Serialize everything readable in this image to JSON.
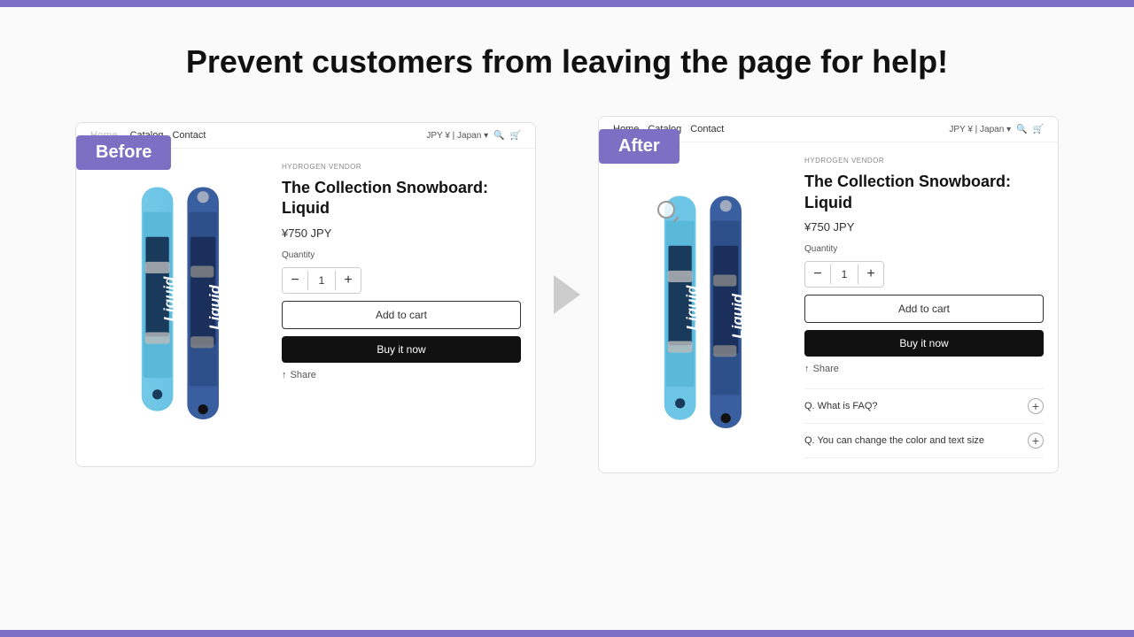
{
  "topBar": {
    "color": "#7c6fc4"
  },
  "headline": "Prevent customers from leaving the page for help!",
  "before": {
    "badge": "Before",
    "nav": {
      "logo": "Home",
      "links": [
        "Catalog",
        "Contact"
      ],
      "right": "JPY ¥ | Japan ▾"
    },
    "vendor": "HYDROGEN VENDOR",
    "title": "The Collection Snowboard: Liquid",
    "price": "¥750 JPY",
    "quantityLabel": "Quantity",
    "quantity": "1",
    "addToCart": "Add to cart",
    "buyNow": "Buy it now",
    "share": "Share"
  },
  "after": {
    "badge": "After",
    "nav": {
      "links": [
        "Home",
        "Catalog",
        "Contact"
      ],
      "right": "JPY ¥ | Japan ▾"
    },
    "vendor": "HYDROGEN VENDOR",
    "title": "The Collection Snowboard: Liquid",
    "price": "¥750 JPY",
    "quantityLabel": "Quantity",
    "quantity": "1",
    "addToCart": "Add to cart",
    "buyNow": "Buy it now",
    "share": "Share",
    "faq": [
      {
        "question": "Q. What is FAQ?"
      },
      {
        "question": "Q. You can change the color and text size"
      }
    ]
  },
  "arrow": "▶",
  "icons": {
    "search": "🔍",
    "cart": "🛒",
    "share": "↑"
  }
}
